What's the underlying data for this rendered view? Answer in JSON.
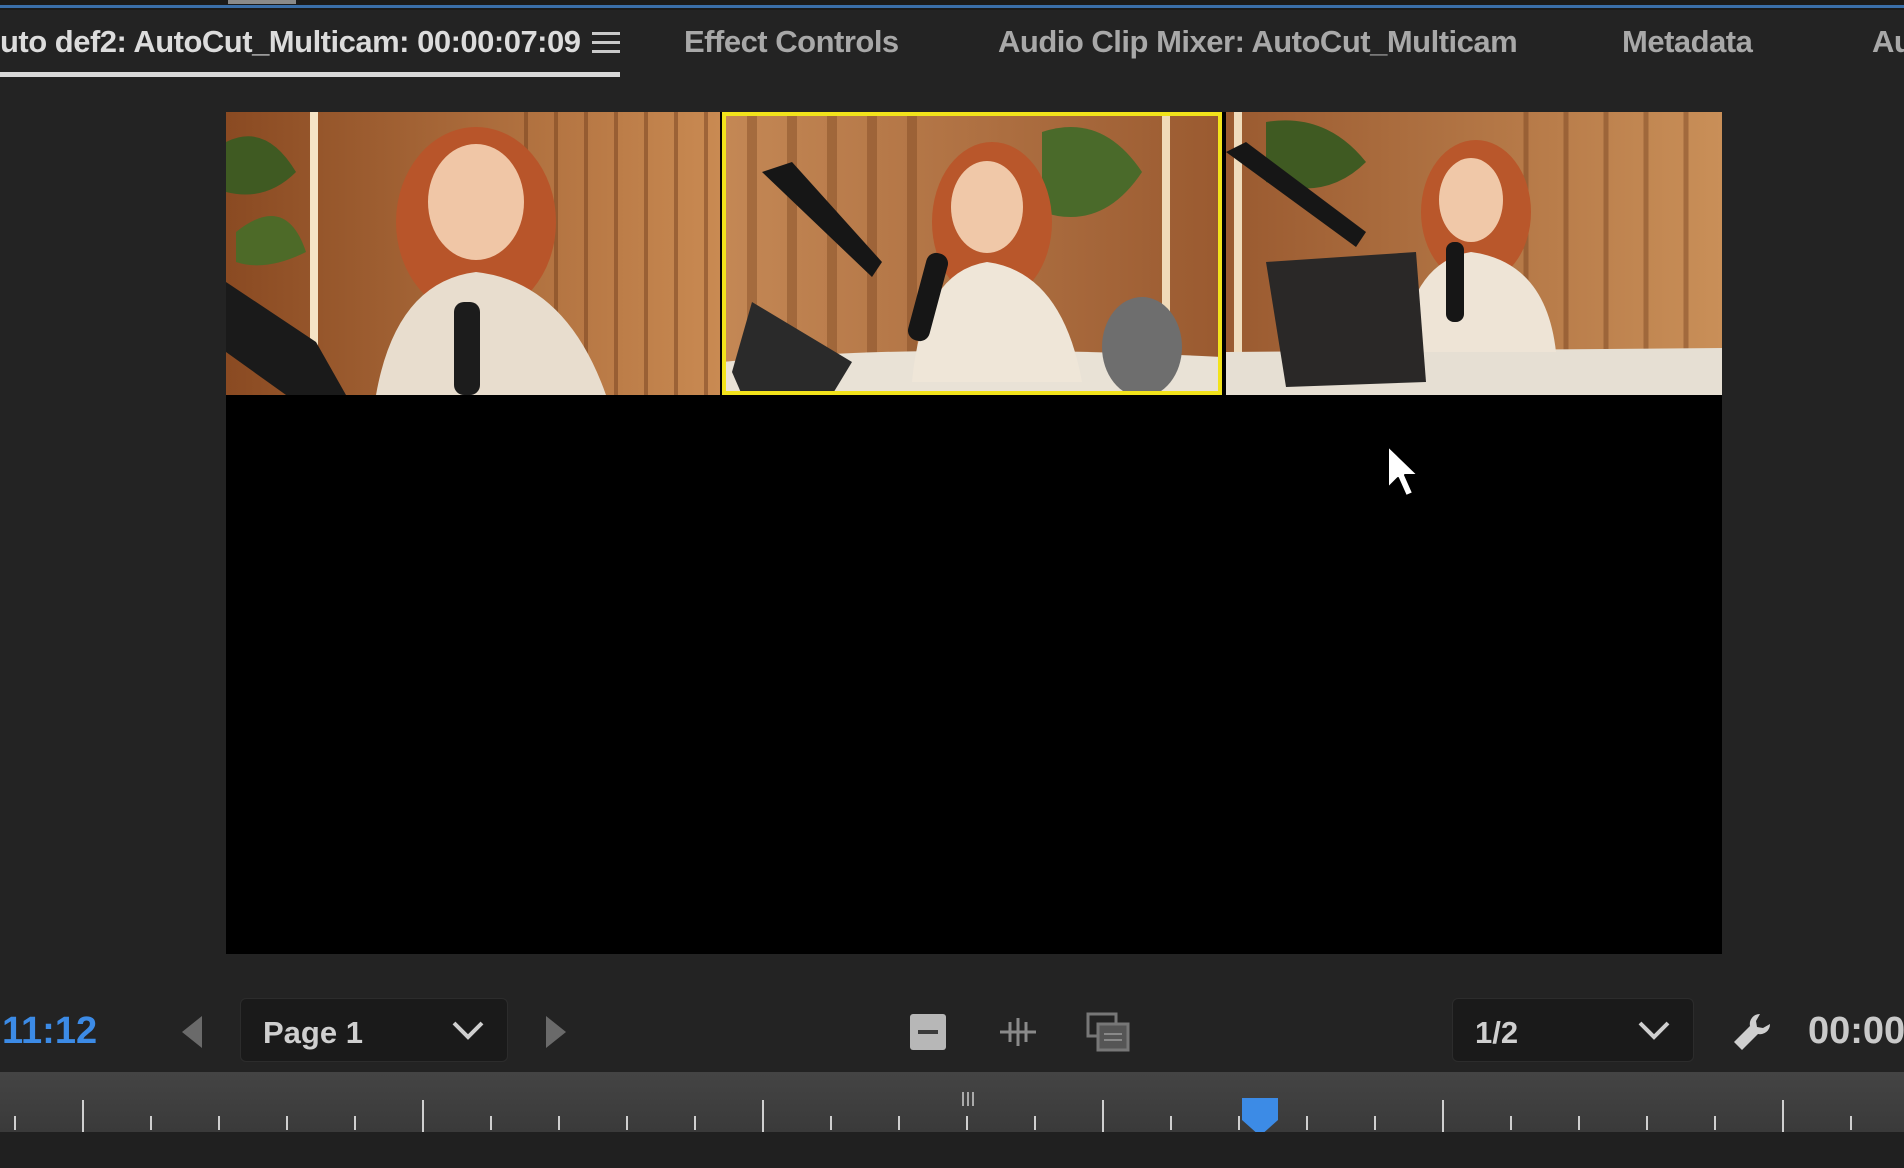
{
  "tabs": [
    {
      "label": "uto def2: AutoCut_Multicam: 00:00:07:09",
      "active": true
    },
    {
      "label": "Effect Controls",
      "active": false
    },
    {
      "label": "Audio Clip Mixer: AutoCut_Multicam",
      "active": false
    },
    {
      "label": "Metadata",
      "active": false
    },
    {
      "label": "Au",
      "active": false
    }
  ],
  "monitor": {
    "cameras": [
      {
        "camera": "camera-1",
        "selected": false
      },
      {
        "camera": "camera-2",
        "selected": true
      },
      {
        "camera": "camera-3",
        "selected": false
      }
    ],
    "selected_color": "#f2e31b"
  },
  "controls": {
    "timecode_left": "11:12",
    "page_select": "Page 1",
    "split_select": "1/2",
    "timecode_right": "00:00"
  },
  "icons": {
    "menu": "hamburger-menu-icon",
    "prev": "triangle-left-icon",
    "next": "triangle-right-icon",
    "cam1": "single-camera-icon",
    "audio": "audio-follow-icon",
    "multi": "multi-camera-icon",
    "settings": "wrench-icon"
  },
  "colors": {
    "timecode": "#3c8be6",
    "playhead": "#3c8be6",
    "panel_bg": "#232323"
  }
}
